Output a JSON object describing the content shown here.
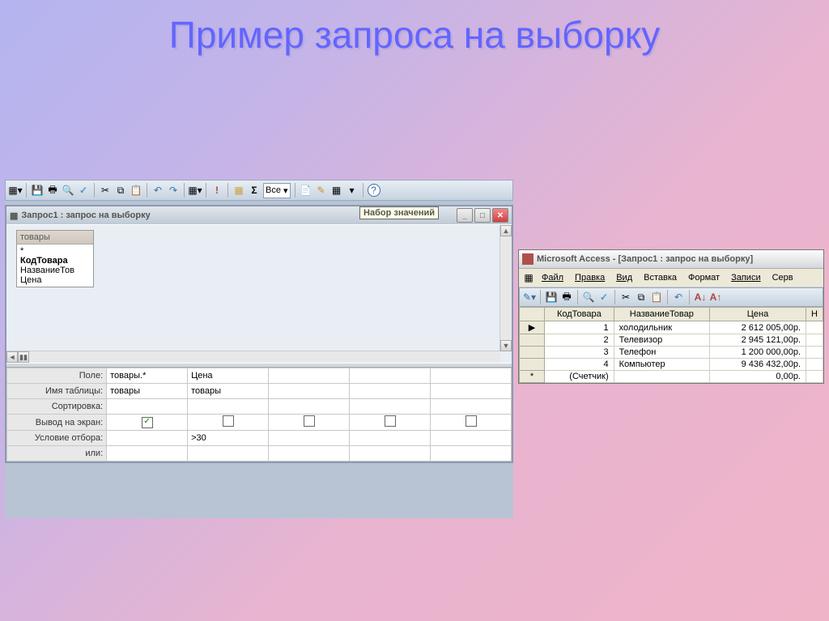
{
  "slide": {
    "title": "Пример запроса на выборку"
  },
  "left": {
    "window_title": "Запрос1 : запрос на выборку",
    "tooltip": "Набор значений",
    "toolbar_dropdown": "Все",
    "table_box": {
      "name": "товары",
      "fields": [
        "*",
        "КодТовара",
        "НазваниеТов",
        "Цена"
      ]
    },
    "grid": {
      "labels": {
        "field": "Поле:",
        "table": "Имя таблицы:",
        "sort": "Сортировка:",
        "show": "Вывод на экран:",
        "criteria": "Условие отбора:",
        "or": "или:"
      },
      "columns": [
        {
          "field": "товары.*",
          "table": "товары",
          "sort": "",
          "show": true,
          "criteria": "",
          "or": ""
        },
        {
          "field": "Цена",
          "table": "товары",
          "sort": "",
          "show": false,
          "criteria": ">30",
          "or": ""
        },
        {
          "field": "",
          "table": "",
          "sort": "",
          "show": false,
          "criteria": "",
          "or": ""
        },
        {
          "field": "",
          "table": "",
          "sort": "",
          "show": false,
          "criteria": "",
          "or": ""
        },
        {
          "field": "",
          "table": "",
          "sort": "",
          "show": false,
          "criteria": "",
          "or": ""
        }
      ]
    }
  },
  "right": {
    "app_title": "Microsoft Access - [Запрос1 : запрос на выборку]",
    "menu": [
      "Файл",
      "Правка",
      "Вид",
      "Вставка",
      "Формат",
      "Записи",
      "Серв"
    ],
    "columns": [
      "КодТовара",
      "НазваниеТовар",
      "Цена",
      "Н"
    ],
    "rows": [
      {
        "id": "1",
        "name": "холодильник",
        "price": "2 612 005,00р."
      },
      {
        "id": "2",
        "name": "Телевизор",
        "price": "2 945 121,00р."
      },
      {
        "id": "3",
        "name": "Телефон",
        "price": "1 200 000,00р."
      },
      {
        "id": "4",
        "name": "Компьютер",
        "price": "9 436 432,00р."
      }
    ],
    "new_row": {
      "id": "(Счетчик)",
      "price": "0,00р."
    }
  }
}
